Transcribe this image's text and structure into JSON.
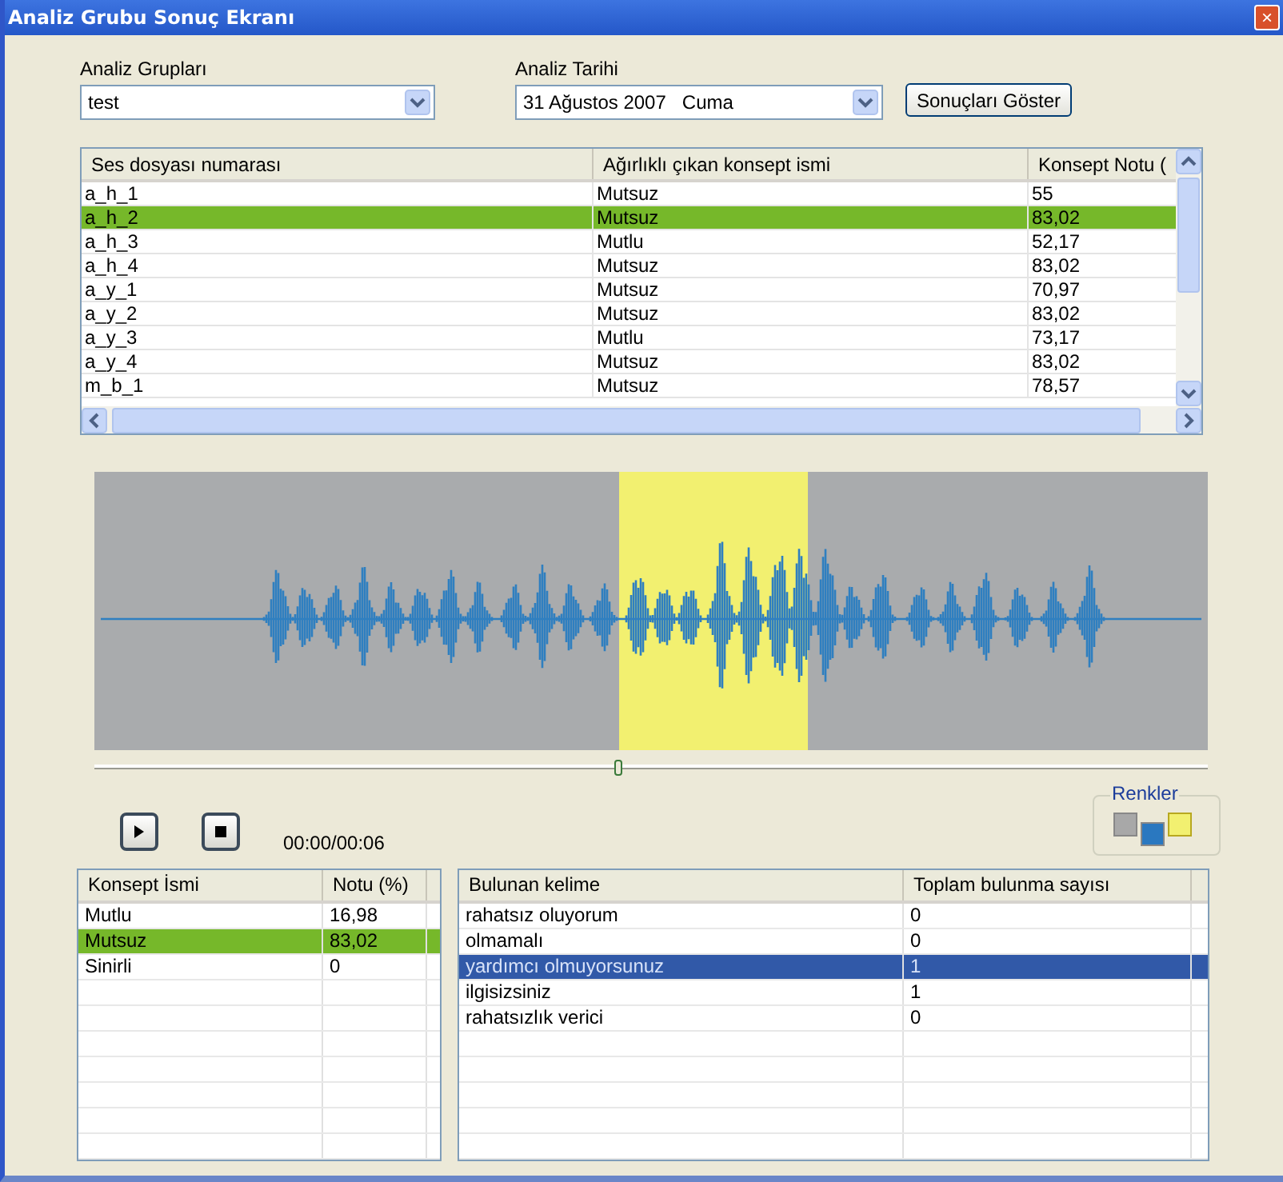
{
  "window": {
    "title": "Analiz Grubu Sonuç Ekranı",
    "close": "×"
  },
  "filters": {
    "group": {
      "label": "Analiz Grupları",
      "value": "test"
    },
    "date": {
      "label": "Analiz Tarihi",
      "value": "31 Ağustos 2007   Cuma"
    },
    "button": "Sonuçları Göster"
  },
  "results": {
    "columns": [
      "Ses dosyası numarası",
      "Ağırlıklı çıkan konsept ismi",
      "Konsept Notu ("
    ],
    "rows": [
      {
        "file": "a_h_1",
        "concept": "Mutsuz",
        "score": "55",
        "selected": false
      },
      {
        "file": "a_h_2",
        "concept": "Mutsuz",
        "score": "83,02",
        "selected": true
      },
      {
        "file": "a_h_3",
        "concept": "Mutlu",
        "score": "52,17",
        "selected": false
      },
      {
        "file": "a_h_4",
        "concept": "Mutsuz",
        "score": "83,02",
        "selected": false
      },
      {
        "file": "a_y_1",
        "concept": "Mutsuz",
        "score": "70,97",
        "selected": false
      },
      {
        "file": "a_y_2",
        "concept": "Mutsuz",
        "score": "83,02",
        "selected": false
      },
      {
        "file": "a_y_3",
        "concept": "Mutlu",
        "score": "73,17",
        "selected": false
      },
      {
        "file": "a_y_4",
        "concept": "Mutsuz",
        "score": "83,02",
        "selected": false
      },
      {
        "file": "m_b_1",
        "concept": "Mutsuz",
        "score": "78,57",
        "selected": false
      }
    ]
  },
  "player": {
    "seek": {
      "level": 0.47
    },
    "time": "00:00/00:06"
  },
  "colors": {
    "label": "Renkler",
    "swatches": [
      {
        "color": "#a8a8a8"
      },
      {
        "color": "#2a78c0"
      },
      {
        "color": "#f2f070"
      }
    ]
  },
  "concepts": {
    "columns": [
      "Konsept İsmi",
      "Notu (%)"
    ],
    "rows": [
      {
        "name": "Mutlu",
        "score": "16,98",
        "selected": false
      },
      {
        "name": "Mutsuz",
        "score": "83,02",
        "selected": true
      },
      {
        "name": "Sinirli",
        "score": "0",
        "selected": false
      }
    ]
  },
  "words": {
    "columns": [
      "Bulunan kelime",
      "Toplam bulunma sayısı"
    ],
    "rows": [
      {
        "word": "rahatsız oluyorum",
        "count": "0",
        "selected": false
      },
      {
        "word": "olmamalı",
        "count": "0",
        "selected": false
      },
      {
        "word": "yardımcı olmuyorsunuz",
        "count": "1",
        "selected": true
      },
      {
        "word": "ilgisizsiniz",
        "count": "1",
        "selected": false
      },
      {
        "word": "rahatsızlık verici",
        "count": "0",
        "selected": false
      }
    ]
  }
}
